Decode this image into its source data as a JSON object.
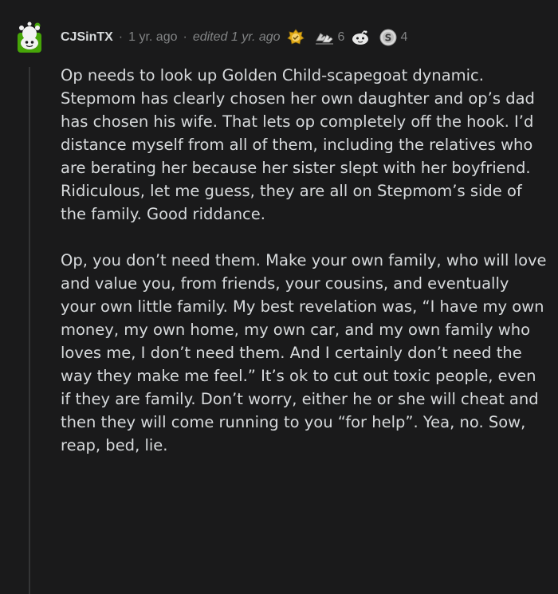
{
  "comment": {
    "username": "CJSinTX",
    "separator": "·",
    "age": "1 yr. ago",
    "edited": "edited 1 yr. ago",
    "awards": [
      {
        "icon": "gold-award-icon",
        "count": ""
      },
      {
        "icon": "hands-award-icon",
        "count": "6"
      },
      {
        "icon": "face-award-icon",
        "count": ""
      },
      {
        "icon": "silver-coin-award-icon",
        "count": "4"
      }
    ],
    "paragraphs": [
      "Op needs to look up Golden Child-scapegoat dynamic. Stepmom has clearly chosen her own daughter and op’s dad has chosen his wife. That lets op completely off the hook. I’d distance myself from all of them, including the relatives who are berating her because her sister slept with her boyfriend. Ridiculous, let me guess, they are all on Stepmom’s side of the family. Good riddance.",
      "Op, you don’t need them. Make your own family, who will love and value you, from friends, your cousins, and eventually your own little family. My best revelation was, “I have my own money, my own home, my own car, and my own family who loves me, I don’t need them. And I certainly don’t need the way they make me feel.” It’s ok to cut out toxic people, even if they are family. Don’t worry, either he or she will cheat and then they will come running to you “for help”. Yea, no. Sow, reap, bed, lie."
    ]
  },
  "colors": {
    "background": "#1a1a1b",
    "text": "#d7dadc",
    "meta": "#818384",
    "thread_line": "#343536",
    "avatar_green": "#46a508"
  }
}
